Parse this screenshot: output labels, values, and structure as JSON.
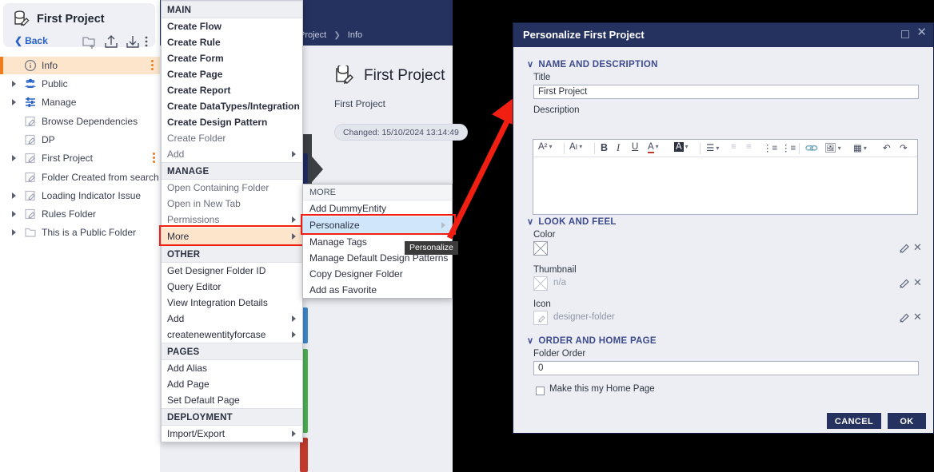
{
  "sidebar": {
    "header": {
      "title": "First Project",
      "back_label": "Back",
      "icons": [
        "new-folder-icon",
        "upload-icon",
        "download-icon",
        "kebab-menu-icon"
      ]
    },
    "tree": [
      {
        "label": "Info",
        "icon": "info-icon",
        "twisty": false,
        "selected": true,
        "kebab": true
      },
      {
        "label": "Public",
        "icon": "users-icon",
        "twisty": true,
        "selected": false,
        "kebab": false
      },
      {
        "label": "Manage",
        "icon": "sliders-icon",
        "twisty": true,
        "selected": false,
        "kebab": false
      },
      {
        "label": "Browse Dependencies",
        "icon": "designer-folder-icon",
        "twisty": false,
        "selected": false,
        "kebab": false
      },
      {
        "label": "DP",
        "icon": "designer-folder-icon",
        "twisty": false,
        "selected": false,
        "kebab": false
      },
      {
        "label": "First Project",
        "icon": "designer-folder-icon",
        "twisty": true,
        "selected": false,
        "kebab": true
      },
      {
        "label": "Folder Created from search ...",
        "icon": "designer-folder-icon",
        "twisty": false,
        "selected": false,
        "kebab": false
      },
      {
        "label": "Loading Indicator Issue",
        "icon": "designer-folder-icon",
        "twisty": true,
        "selected": false,
        "kebab": false
      },
      {
        "label": "Rules Folder",
        "icon": "designer-folder-icon",
        "twisty": true,
        "selected": false,
        "kebab": false
      },
      {
        "label": "This is a Public Folder",
        "icon": "folder-icon",
        "twisty": true,
        "selected": false,
        "kebab": false
      }
    ]
  },
  "background": {
    "breadcrumb": [
      "Project",
      "Info"
    ],
    "project_title": "First Project",
    "project_subtitle": "First Project",
    "changed_pill": "Changed: 15/10/2024 13:14:49"
  },
  "context_menu": {
    "sections": [
      {
        "title": "MAIN",
        "items": [
          {
            "label": "Create Flow",
            "bold": true,
            "dim": false,
            "submenu": false
          },
          {
            "label": "Create Rule",
            "bold": true,
            "dim": false,
            "submenu": false
          },
          {
            "label": "Create Form",
            "bold": true,
            "dim": false,
            "submenu": false
          },
          {
            "label": "Create Page",
            "bold": true,
            "dim": false,
            "submenu": false
          },
          {
            "label": "Create Report",
            "bold": true,
            "dim": false,
            "submenu": false
          },
          {
            "label": "Create DataTypes/Integration",
            "bold": true,
            "dim": false,
            "submenu": false
          },
          {
            "label": "Create Design Pattern",
            "bold": true,
            "dim": false,
            "submenu": false
          },
          {
            "label": "Create Folder",
            "bold": false,
            "dim": true,
            "submenu": false
          },
          {
            "label": "Add",
            "bold": false,
            "dim": true,
            "submenu": true
          }
        ]
      },
      {
        "title": "MANAGE",
        "items": [
          {
            "label": "Open Containing Folder",
            "bold": false,
            "dim": true,
            "submenu": false
          },
          {
            "label": "Open in New Tab",
            "bold": false,
            "dim": true,
            "submenu": false
          },
          {
            "label": "Permissions",
            "bold": false,
            "dim": true,
            "submenu": true
          },
          {
            "label": "More",
            "bold": false,
            "dim": false,
            "submenu": true,
            "highlighted": true
          }
        ]
      },
      {
        "title": "OTHER",
        "items": [
          {
            "label": "Get Designer Folder ID",
            "bold": false,
            "dim": false,
            "submenu": false
          },
          {
            "label": "Query Editor",
            "bold": false,
            "dim": false,
            "submenu": false
          },
          {
            "label": "View Integration Details",
            "bold": false,
            "dim": false,
            "submenu": false
          },
          {
            "label": "Add",
            "bold": false,
            "dim": false,
            "submenu": true
          },
          {
            "label": "createnewentityforcase",
            "bold": false,
            "dim": false,
            "submenu": true
          }
        ]
      },
      {
        "title": "PAGES",
        "items": [
          {
            "label": "Add Alias",
            "bold": false,
            "dim": false,
            "submenu": false
          },
          {
            "label": "Add Page",
            "bold": false,
            "dim": false,
            "submenu": false
          },
          {
            "label": "Set Default Page",
            "bold": false,
            "dim": false,
            "submenu": false
          }
        ]
      },
      {
        "title": "DEPLOYMENT",
        "items": [
          {
            "label": "Import/Export",
            "bold": false,
            "dim": false,
            "submenu": true
          }
        ]
      }
    ]
  },
  "sub_menu": {
    "title": "MORE",
    "tooltip": "Personalize",
    "items": [
      {
        "label": "Add DummyEntity",
        "active": false,
        "submenu": false
      },
      {
        "label": "Personalize",
        "active": true,
        "submenu": true
      },
      {
        "label": "Manage Tags",
        "active": false,
        "submenu": false
      },
      {
        "label": "Manage Default Design Patterns",
        "active": false,
        "submenu": false
      },
      {
        "label": "Copy Designer Folder",
        "active": false,
        "submenu": false
      },
      {
        "label": "Add as Favorite",
        "active": false,
        "submenu": false
      }
    ]
  },
  "dialog": {
    "title": "Personalize First Project",
    "window_controls": [
      "maximize-icon",
      "close-icon"
    ],
    "sections": {
      "name_and_description": {
        "header": "NAME AND DESCRIPTION",
        "title_label": "Title",
        "title_value": "First Project",
        "description_label": "Description",
        "description_value": "",
        "toolbar": [
          "font-family-icon",
          "font-size-icon",
          "bold-icon",
          "italic-icon",
          "underline-icon",
          "text-color-icon",
          "highlight-color-icon",
          "align-icon",
          "outdent-icon",
          "indent-icon",
          "bullet-list-icon",
          "numbered-list-icon",
          "link-icon",
          "image-icon",
          "table-icon",
          "undo-icon",
          "redo-icon"
        ]
      },
      "look_and_feel": {
        "header": "LOOK AND FEEL",
        "color_label": "Color",
        "color_value": "",
        "thumbnail_label": "Thumbnail",
        "thumbnail_value": "n/a",
        "icon_label": "Icon",
        "icon_value": "designer-folder"
      },
      "order_and_home_page": {
        "header": "ORDER AND HOME PAGE",
        "folder_order_label": "Folder Order",
        "folder_order_value": "0",
        "home_page_checkbox_label": "Make this my Home Page",
        "home_page_checked": false
      }
    },
    "buttons": {
      "cancel": "CANCEL",
      "ok": "OK"
    }
  },
  "colors": {
    "accent_navy": "#25315f",
    "highlight_orange": "#fde5cc",
    "selection_blue": "#cfe6fb",
    "annotation_red": "#f01f12",
    "bars": [
      "#1f2c63",
      "#3d87cc",
      "#4caf50",
      "#c0392b"
    ]
  }
}
